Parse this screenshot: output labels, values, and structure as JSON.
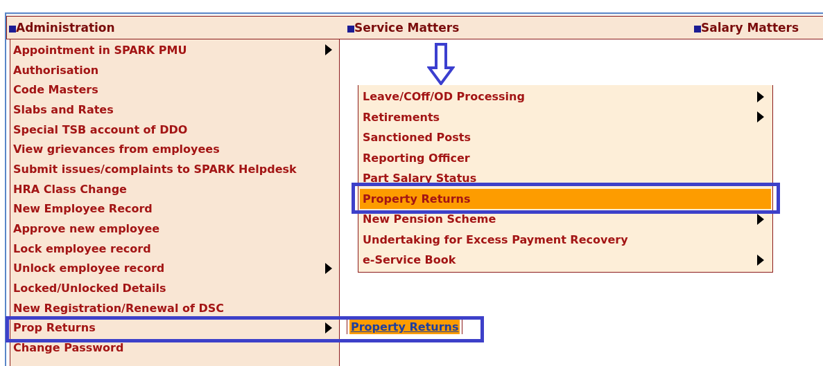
{
  "menu_bar": [
    {
      "label": "Administration"
    },
    {
      "label": "Service Matters"
    },
    {
      "label": "Salary Matters"
    }
  ],
  "administration_menu": {
    "items": [
      {
        "label": "Appointment in SPARK PMU",
        "submenu": true
      },
      {
        "label": "Authorisation",
        "submenu": false
      },
      {
        "label": "Code Masters",
        "submenu": false
      },
      {
        "label": "Slabs and Rates",
        "submenu": false
      },
      {
        "label": "Special TSB account of DDO",
        "submenu": false
      },
      {
        "label": "View grievances from employees",
        "submenu": false
      },
      {
        "label": "Submit issues/complaints to SPARK Helpdesk",
        "submenu": false
      },
      {
        "label": "HRA Class Change",
        "submenu": false
      },
      {
        "label": "New Employee Record",
        "submenu": false
      },
      {
        "label": "Approve new employee",
        "submenu": false
      },
      {
        "label": "Lock employee record",
        "submenu": false
      },
      {
        "label": "Unlock employee record",
        "submenu": true
      },
      {
        "label": "Locked/Unlocked Details",
        "submenu": false
      },
      {
        "label": "New Registration/Renewal of DSC",
        "submenu": false
      },
      {
        "label": "Prop Returns",
        "submenu": true
      },
      {
        "label": "Change Password",
        "submenu": false
      }
    ]
  },
  "service_matters_menu": {
    "items": [
      {
        "label": "Leave/COff/OD Processing",
        "submenu": true,
        "selected": false
      },
      {
        "label": "Retirements",
        "submenu": true,
        "selected": false
      },
      {
        "label": "Sanctioned Posts",
        "submenu": false,
        "selected": false
      },
      {
        "label": "Reporting Officer",
        "submenu": false,
        "selected": false
      },
      {
        "label": "Part Salary Status",
        "submenu": false,
        "selected": false
      },
      {
        "label": "Property Returns",
        "submenu": false,
        "selected": true
      },
      {
        "label": "New Pension Scheme",
        "submenu": true,
        "selected": false
      },
      {
        "label": "Undertaking for Excess Payment Recovery",
        "submenu": false,
        "selected": false
      },
      {
        "label": "e-Service Book",
        "submenu": true,
        "selected": false
      }
    ]
  },
  "prop_returns_submenu": {
    "items": [
      {
        "label": "Property Returns",
        "selected": true
      }
    ]
  }
}
